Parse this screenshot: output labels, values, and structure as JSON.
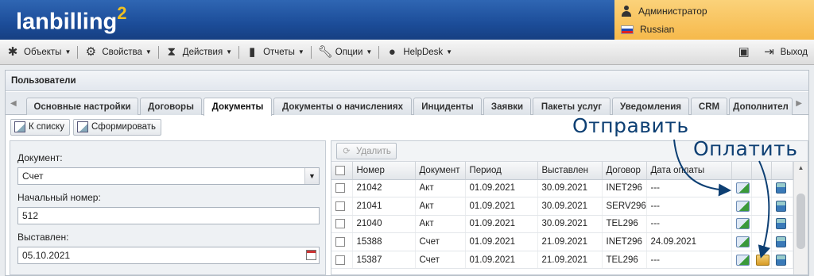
{
  "header": {
    "logo_text": "lanbilling",
    "logo_sup": "2",
    "user_name": "Администратор",
    "language": "Russian"
  },
  "menu": {
    "items": [
      {
        "label": "Объекты",
        "icon": "puzzle-icon"
      },
      {
        "label": "Свойства",
        "icon": "gear-icon"
      },
      {
        "label": "Действия",
        "icon": "hourglass-icon"
      },
      {
        "label": "Отчеты",
        "icon": "bar-chart-icon"
      },
      {
        "label": "Опции",
        "icon": "wrench-icon"
      },
      {
        "label": "HelpDesk",
        "icon": "chat-icon"
      }
    ],
    "logout_label": "Выход"
  },
  "panel": {
    "title": "Пользователи",
    "tabs": [
      "Основные настройки",
      "Договоры",
      "Документы",
      "Документы о начислениях",
      "Инциденты",
      "Заявки",
      "Пакеты услуг",
      "Уведомления",
      "CRM",
      "Дополнител"
    ],
    "active_tab": "Документы",
    "toolbar": {
      "to_list_label": "К списку",
      "generate_label": "Сформировать"
    }
  },
  "form": {
    "document_label": "Документ:",
    "document_value": "Счет",
    "start_number_label": "Начальный номер:",
    "start_number_value": "512",
    "issued_label": "Выставлен:",
    "issued_value": "05.10.2021"
  },
  "grid": {
    "delete_label": "Удалить",
    "columns": [
      "Номер",
      "Документ",
      "Период",
      "Выставлен",
      "Договор",
      "Дата оплаты"
    ],
    "rows": [
      {
        "number": "21042",
        "doc": "Акт",
        "period": "01.09.2021",
        "issued": "30.09.2021",
        "contract": "INET296",
        "paid": "---",
        "pay_icon": false
      },
      {
        "number": "21041",
        "doc": "Акт",
        "period": "01.09.2021",
        "issued": "30.09.2021",
        "contract": "SERV296",
        "paid": "---",
        "pay_icon": false
      },
      {
        "number": "21040",
        "doc": "Акт",
        "period": "01.09.2021",
        "issued": "30.09.2021",
        "contract": "TEL296",
        "paid": "---",
        "pay_icon": false
      },
      {
        "number": "15388",
        "doc": "Счет",
        "period": "01.09.2021",
        "issued": "21.09.2021",
        "contract": "INET296",
        "paid": "24.09.2021",
        "pay_icon": false
      },
      {
        "number": "15387",
        "doc": "Счет",
        "period": "01.09.2021",
        "issued": "21.09.2021",
        "contract": "TEL296",
        "paid": "---",
        "pay_icon": true
      }
    ]
  },
  "annotations": {
    "send": "Отправить",
    "pay": "Оплатить",
    "arrow_color": "#0d3f73"
  }
}
